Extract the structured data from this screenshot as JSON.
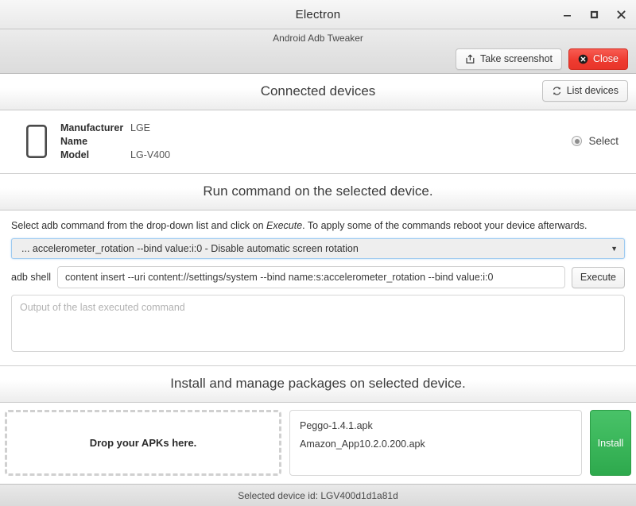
{
  "window": {
    "title": "Electron",
    "minimize_label": "Minimize",
    "maximize_label": "Maximize",
    "close_label": "Close"
  },
  "app": {
    "subtitle": "Android Adb Tweaker",
    "take_screenshot_label": "Take screenshot",
    "close_label": "Close"
  },
  "devices_section": {
    "title": "Connected devices",
    "list_devices_label": "List devices",
    "device": {
      "manufacturer_label": "Manufacturer",
      "manufacturer_value": "LGE",
      "name_label": "Name",
      "name_value": "",
      "model_label": "Model",
      "model_value": "LG-V400",
      "select_label": "Select"
    }
  },
  "command_section": {
    "title": "Run command on the selected device.",
    "hint_part1": "Select adb command from the drop-down list and click on ",
    "hint_emphasis": "Execute",
    "hint_part2": ". To apply some of the commands reboot your device afterwards.",
    "selected_command": "... accelerometer_rotation --bind value:i:0 - Disable automatic screen rotation",
    "dropdown_arrow": "▼",
    "shell_label": "adb shell",
    "shell_value": "content insert --uri content://settings/system --bind name:s:accelerometer_rotation --bind value:i:0",
    "execute_label": "Execute",
    "output_placeholder": "Output of the last executed command",
    "output_value": ""
  },
  "packages_section": {
    "title": "Install and manage packages on selected device.",
    "dropzone_label": "Drop your APKs here.",
    "apk_files": [
      "Peggo-1.4.1.apk",
      "Amazon_App10.2.0.200.apk"
    ],
    "install_label": "Install"
  },
  "statusbar": {
    "text": "Selected device id: LGV400d1d1a81d"
  },
  "colors": {
    "danger": "#ef3b30",
    "success": "#3cb85c",
    "focus_border": "#9ecaf0",
    "titlebar_bg": "#ececec"
  }
}
